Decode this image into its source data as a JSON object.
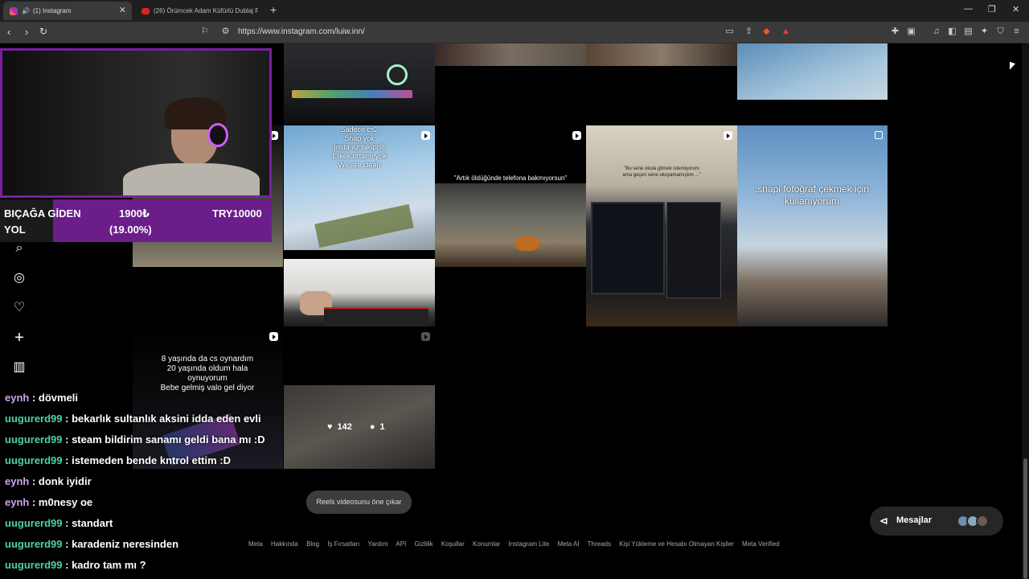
{
  "browser": {
    "tabs": [
      {
        "title": "(1) Instagram",
        "active": true
      },
      {
        "title": "(26) Örümcek Adam Küfürlü Dublaj P",
        "active": false
      }
    ],
    "url": "https://www.instagram.com/luiw.inn/"
  },
  "grid": {
    "captions": {
      "cs2_lines": [
        "Sadece cs2",
        "Snap yok",
        "İnsta az takipcili",
        "Erkek ortamı yok",
        "We are clean"
      ],
      "phone": "\"Artık öldüğünde telefona bakmıyorsun\"",
      "desk": "\"Bu sene okula gitmek istemiyorum ama geçen sene okuyamamıştım ...\"",
      "snap": ":snapi fotoğraf çekmek için kullanıyorum",
      "cs_age_lines": [
        "8 yaşında da cs oynardım",
        "20 yaşında oldum hala",
        "oynuyorum",
        "Bebe gelmiş valo gel diyor"
      ]
    },
    "hover": {
      "likes": "142",
      "comments": "1"
    }
  },
  "stream": {
    "donation": {
      "label_line1": "BIÇAĞA GİDEN",
      "label_line2": "YOL",
      "current": "1900₺",
      "percent": "(19.00%)",
      "goal": "TRY10000"
    },
    "chat": [
      {
        "user": "eynh",
        "text": ": dövmeli",
        "color": "u1"
      },
      {
        "user": "uugurerd99",
        "text": ": bekarlık sultanlık aksini idda eden evli",
        "color": "u2"
      },
      {
        "user": "uugurerd99",
        "text": ": steam bildirim sanamı geldi bana mı :D",
        "color": "u2"
      },
      {
        "user": "uugurerd99",
        "text": ": istemeden bende kntrol ettim :D",
        "color": "u2"
      },
      {
        "user": "eynh",
        "text": ": donk iyidir",
        "color": "u1"
      },
      {
        "user": "eynh",
        "text": ": m0nesy oe",
        "color": "u1"
      },
      {
        "user": "uugurerd99",
        "text": ": standart",
        "color": "u2"
      },
      {
        "user": "uugurerd99",
        "text": ": karadeniz neresinden",
        "color": "u2"
      },
      {
        "user": "uugurerd99",
        "text": ": kadro tam mı ?",
        "color": "u2"
      }
    ]
  },
  "instagram": {
    "pin_reel_label": "Reels videosunu öne çıkar",
    "messages_label": "Mesajlar",
    "footer_links": [
      "Meta",
      "Hakkında",
      "Blog",
      "İş Fırsatları",
      "Yardım",
      "API",
      "Gizlilik",
      "Koşullar",
      "Konumlar",
      "Instagram Lite",
      "Meta AI",
      "Threads",
      "Kişi Yükleme ve Hesabı Olmayan Kişiler",
      "Meta Verified"
    ]
  },
  "colors": {
    "accent_purple": "#7a1fa0",
    "chat_user_purple": "#c9a6e8",
    "chat_user_green": "#4fd2a0"
  }
}
